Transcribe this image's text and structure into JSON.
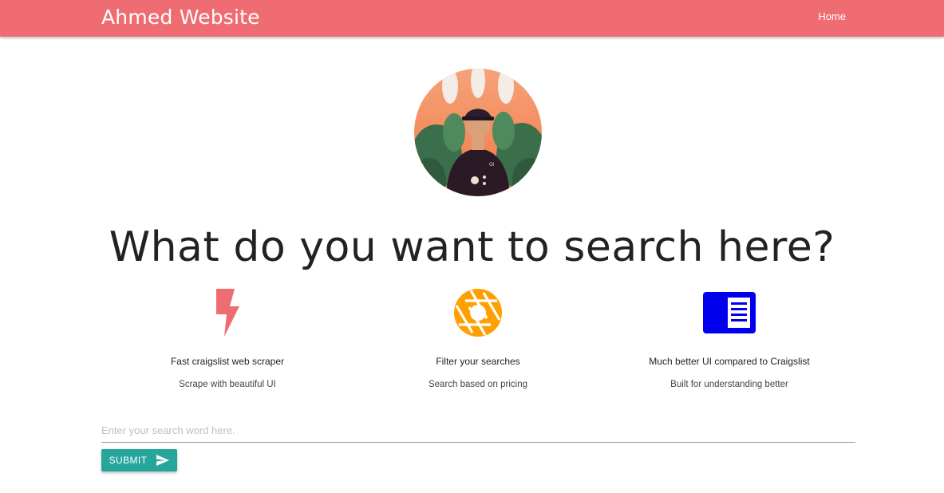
{
  "navbar": {
    "brand": "Ahmed Website",
    "links": [
      "Home"
    ],
    "color": "#ef6c72"
  },
  "hero": {
    "avatar_icon": "profile-photo",
    "headline": "What do you want to search here?"
  },
  "features": [
    {
      "icon": "lightning-bolt-icon",
      "icon_color": "#ef6c72",
      "title": "Fast craigslist web scraper",
      "subtitle": "Scrape with beautiful UI"
    },
    {
      "icon": "camera-aperture-icon",
      "icon_color": "#ffa000",
      "title": "Filter your searches",
      "subtitle": "Search based on pricing"
    },
    {
      "icon": "chrome-reader-icon",
      "icon_color": "#0000ee",
      "title": "Much better UI compared to Craigslist",
      "subtitle": "Built for understanding better"
    }
  ],
  "search": {
    "placeholder": "Enter your search word here.",
    "value": "",
    "submit_label": "SUBMIT",
    "submit_icon": "send-icon",
    "button_color": "#26a69a"
  }
}
